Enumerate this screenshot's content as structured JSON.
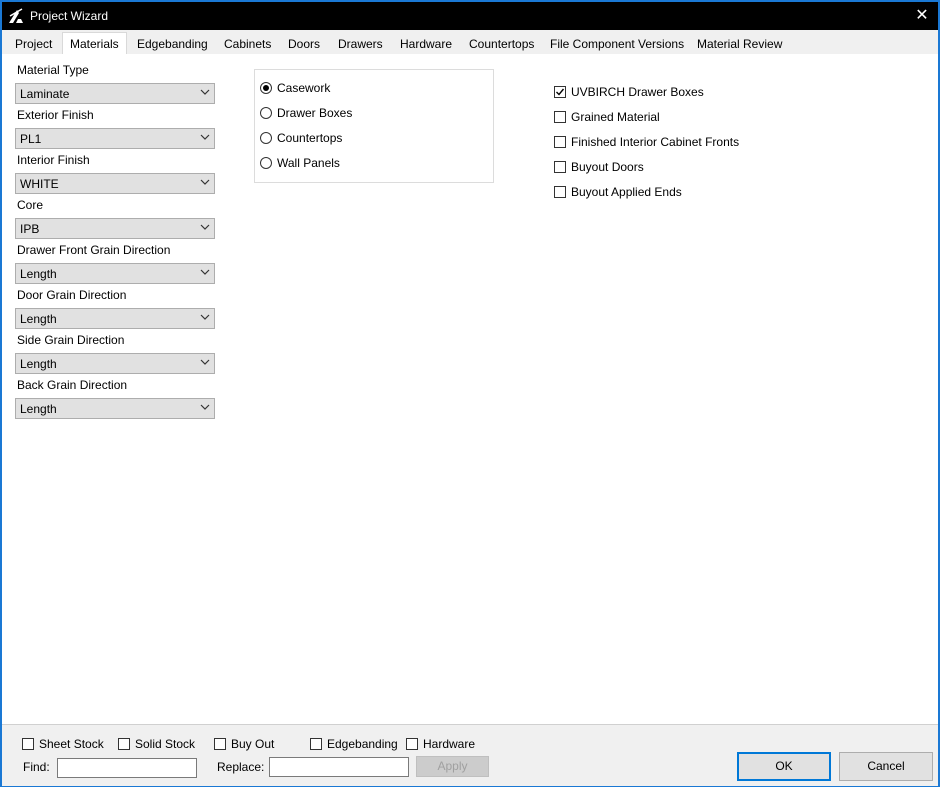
{
  "window": {
    "title": "Project Wizard",
    "close_symbol": "✕"
  },
  "tabs": [
    "Project",
    "Materials",
    "Edgebanding",
    "Cabinets",
    "Doors",
    "Drawers",
    "Hardware",
    "Countertops",
    "File Component Versions",
    "Material Review"
  ],
  "active_tab": "Materials",
  "fields": [
    {
      "label": "Material Type",
      "value": "Laminate"
    },
    {
      "label": "Exterior Finish",
      "value": "PL1"
    },
    {
      "label": "Interior Finish",
      "value": "WHITE"
    },
    {
      "label": "Core",
      "value": "IPB"
    },
    {
      "label": "Drawer Front Grain Direction",
      "value": "Length"
    },
    {
      "label": "Door Grain Direction",
      "value": "Length"
    },
    {
      "label": "Side Grain Direction",
      "value": "Length"
    },
    {
      "label": "Back Grain Direction",
      "value": "Length"
    }
  ],
  "radio_options": [
    {
      "label": "Casework",
      "selected": true
    },
    {
      "label": "Drawer Boxes",
      "selected": false
    },
    {
      "label": "Countertops",
      "selected": false
    },
    {
      "label": "Wall Panels",
      "selected": false
    }
  ],
  "checkboxes": [
    {
      "label": "UVBIRCH Drawer Boxes",
      "checked": true
    },
    {
      "label": "Grained Material",
      "checked": false
    },
    {
      "label": "Finished Interior Cabinet Fronts",
      "checked": false
    },
    {
      "label": "Buyout Doors",
      "checked": false
    },
    {
      "label": "Buyout Applied Ends",
      "checked": false
    }
  ],
  "filters": [
    {
      "label": "Sheet Stock",
      "checked": false
    },
    {
      "label": "Solid Stock",
      "checked": false
    },
    {
      "label": "Buy Out",
      "checked": false
    },
    {
      "label": "Edgebanding",
      "checked": false
    },
    {
      "label": "Hardware",
      "checked": false
    }
  ],
  "find": {
    "label": "Find:",
    "value": ""
  },
  "replace": {
    "label": "Replace:",
    "value": ""
  },
  "buttons": {
    "apply": "Apply",
    "ok": "OK",
    "cancel": "Cancel"
  },
  "colors": {
    "window_border": "#1a78d4",
    "titlebar": "#000000",
    "default_button_border": "#0078d7"
  }
}
